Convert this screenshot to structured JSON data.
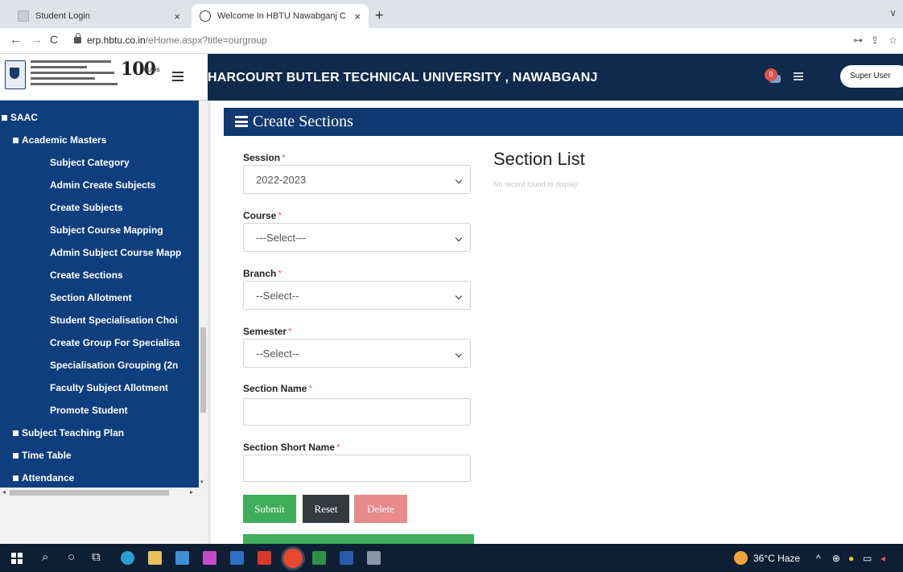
{
  "browser": {
    "tabs": [
      {
        "label": "Student Login",
        "active": false
      },
      {
        "label": "Welcome In HBTU Nawabganj C",
        "active": true
      }
    ],
    "new_tab": "+",
    "tab_close": "×",
    "url_host": "erp.hbtu.co.in",
    "url_path": "/eHome.aspx?title=ourgroup",
    "nav": {
      "back": "←",
      "forward": "→",
      "reload": "C"
    },
    "tabs_menu": "∨"
  },
  "header": {
    "logo_hundred": "100",
    "logo_sub": "YEARS",
    "title": "HARCOURT BUTLER TECHNICAL UNIVERSITY , NAWABGANJ",
    "notification_count": "0",
    "user": "Super User"
  },
  "sidebar": {
    "items": [
      {
        "label": "SAAC",
        "level": 0,
        "bullet": "minus"
      },
      {
        "label": "Academic Masters",
        "level": 1,
        "bullet": "minus"
      },
      {
        "label": "Subject Category",
        "level": 2
      },
      {
        "label": "Admin Create Subjects",
        "level": 2
      },
      {
        "label": "Create Subjects",
        "level": 2
      },
      {
        "label": "Subject Course Mapping",
        "level": 2
      },
      {
        "label": "Admin Subject Course Mapp",
        "level": 2
      },
      {
        "label": "Create Sections",
        "level": 2
      },
      {
        "label": "Section Allotment",
        "level": 2
      },
      {
        "label": "Student Specialisation Choi",
        "level": 2
      },
      {
        "label": "Create Group For Specialisa",
        "level": 2
      },
      {
        "label": "Specialisation Grouping (2n",
        "level": 2
      },
      {
        "label": "Faculty Subject Allotment",
        "level": 2
      },
      {
        "label": "Promote Student",
        "level": 2
      },
      {
        "label": "Subject Teaching Plan",
        "level": 1,
        "bullet": "plus"
      },
      {
        "label": "Time Table",
        "level": 1,
        "bullet": "plus"
      },
      {
        "label": "Attendance",
        "level": 1,
        "bullet": "plus"
      }
    ]
  },
  "page": {
    "title": "Create Sections",
    "list_title": "Section List",
    "empty_message": "No record found to display"
  },
  "form": {
    "required_mark": "*",
    "session": {
      "label": "Session",
      "value": "2022-2023"
    },
    "course": {
      "label": "Course",
      "value": "---Select---"
    },
    "branch": {
      "label": "Branch",
      "value": "--Select--"
    },
    "semester": {
      "label": "Semester",
      "value": "--Select--"
    },
    "section_name": {
      "label": "Section Name",
      "value": ""
    },
    "section_short_name": {
      "label": "Section Short Name",
      "value": ""
    },
    "buttons": {
      "submit": "Submit",
      "reset": "Reset",
      "delete": "Delete"
    }
  },
  "colors": {
    "header_bg": "#0f2a4d",
    "sidebar_bg": "#0e3e7d",
    "section_header_bg": "#0f3970",
    "submit": "#3fae5a",
    "reset": "#343a40",
    "delete": "#e88a8a"
  },
  "taskbar": {
    "weather": "36°C Haze",
    "tray_chevron": "^"
  }
}
